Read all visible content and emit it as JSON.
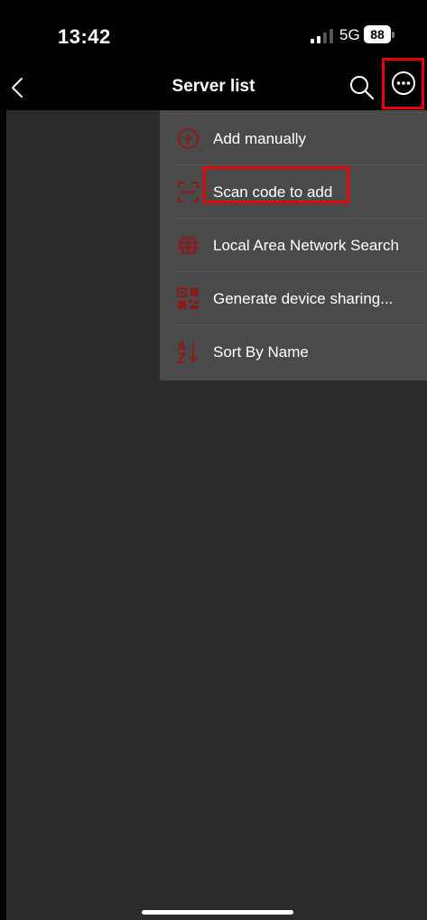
{
  "status_bar": {
    "time": "13:42",
    "network": "5G",
    "battery": "88"
  },
  "nav": {
    "title": "Server list"
  },
  "menu": {
    "items": [
      {
        "label": "Add manually",
        "icon": "add-circle-icon"
      },
      {
        "label": "Scan code to add",
        "icon": "scan-icon"
      },
      {
        "label": "Local Area Network Search",
        "icon": "globe-icon"
      },
      {
        "label": "Generate device sharing...",
        "icon": "qr-code-icon"
      },
      {
        "label": "Sort By Name",
        "icon": "sort-az-icon"
      }
    ]
  },
  "colors": {
    "accent": "#8b1a1a",
    "highlight_box": "#e8000b",
    "menu_bg": "#4a4a4a",
    "content_bg": "#2b2b2b"
  }
}
